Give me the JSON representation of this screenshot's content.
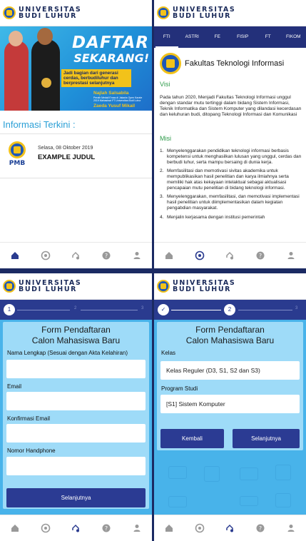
{
  "brand": {
    "line1": "UNIVERSITAS",
    "line2": "BUDI LUHUR"
  },
  "colors": {
    "primary": "#2b3b93",
    "accent": "#2a9fd6",
    "green": "#2e9b4a",
    "yellow": "#f2c21a",
    "form_bg": "#48b3ea"
  },
  "nav": {
    "icons": [
      "home-icon",
      "chrome-icon",
      "sync-icon",
      "help-icon",
      "person-icon"
    ]
  },
  "home": {
    "banner": {
      "headline1": "DAFTAR",
      "headline2": "SEKARANG!",
      "tagline": "Jadi bagian dari generasi cerdas, berbudiluhur dan berprestasi selanjutnya",
      "person1_name": "Najlah Salsabila",
      "person1_desc": "Peraih Medali Emas di Jakarta Open Karate 2019 Mahasiswi FT Universitas Budi Luhur",
      "person2_name": "Zaeda Yusuf Mikail"
    },
    "section_title": "Informasi Terkini :",
    "news": [
      {
        "date": "Selasa, 08 Oktober 2019",
        "title": "EXAMPLE JUDUL",
        "logo_text": "PMB"
      }
    ]
  },
  "faculty": {
    "tabs": [
      "FTI",
      "ASTRI",
      "FE",
      "FISIP",
      "FT",
      "FIKOM"
    ],
    "active_tab": "FTI",
    "title": "Fakultas Teknologi Informasi",
    "visi_heading": "Visi",
    "visi_text": "Pada tahun 2020, Menjadi Fakultas Teknologi Informasi unggul dengan standar mutu tertinggi dalam bidang Sistem Informasi, Teknik Informatika dan Sistem Komputer yang dilandasi kecerdasan dan keluhuran budi, ditopang Teknologi Informasi dan Komunikasi",
    "misi_heading": "Misi",
    "misi": [
      {
        "num": "1.",
        "text": "Menyelenggarakan pendidikan teknologi informasi berbasis kompetensi untuk menghasilkan lulusan yang unggul, cerdas dan berbudi luhur, serta mampu bersaing di dunia kerja."
      },
      {
        "num": "2.",
        "text": "Memfasilitasi dan memotivasi sivitas akademika untuk mempublikasikan hasil penelitian dan karya ilmiahnya serta memiliki hak atas kekayaan intelaktual sebagai aktualisasi pencapaian mutu penelitian di bidang teknologi informasi."
      },
      {
        "num": "3.",
        "text": "Menyelenggarakan, memfasilitasi, dan memotivasi implementasi hasil penelitian untuk diimplementasikan dalam kegiatan pengabdian masyarakat."
      },
      {
        "num": "4.",
        "text": "Menjalin kerjasama dengan institusi pemerintah"
      }
    ]
  },
  "form1": {
    "step_current": "1",
    "step_2": "2",
    "step_3": "3",
    "title_line1": "Form Pendaftaran",
    "title_line2": "Calon Mahasiswa Baru",
    "fields": [
      {
        "label": "Nama Lengkap (Sesuai dengan Akta Kelahiran)",
        "value": ""
      },
      {
        "label": "Email",
        "value": ""
      },
      {
        "label": "Konfirmasi Email",
        "value": ""
      },
      {
        "label": "Nomor Handphone",
        "value": ""
      }
    ],
    "next_button": "Selanjutnya"
  },
  "form2": {
    "step_done": "✓",
    "step_current": "2",
    "step_3": "3",
    "title_line1": "Form Pendaftaran",
    "title_line2": "Calon Mahasiswa Baru",
    "kelas_label": "Kelas",
    "kelas_value": "Kelas Reguler (D3, S1, S2 dan S3)",
    "prodi_label": "Program Studi",
    "prodi_value": "[S1] Sistem Komputer",
    "back_button": "Kembali",
    "next_button": "Selanjutnya"
  }
}
